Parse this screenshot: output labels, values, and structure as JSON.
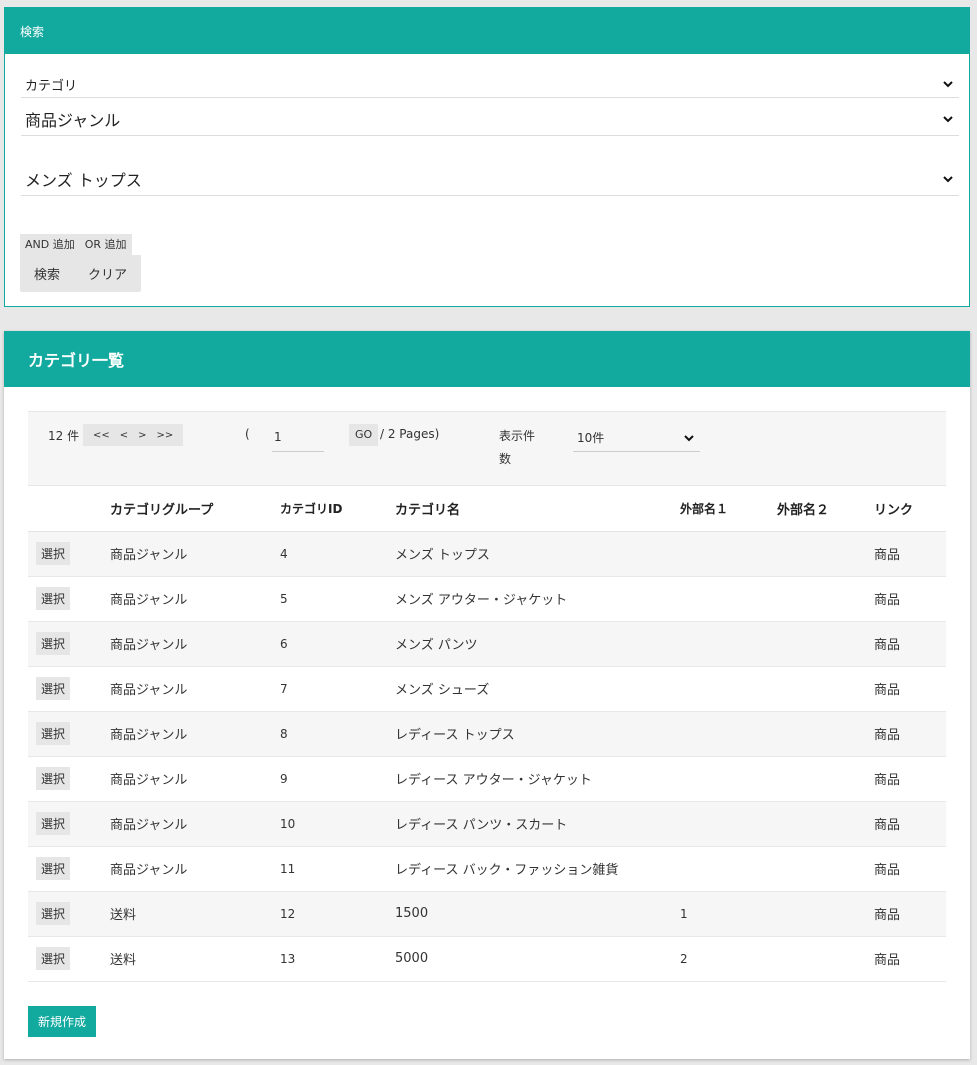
{
  "search": {
    "title": "検索",
    "category_label": "カテゴリ",
    "genre_select": "商品ジャンル",
    "category_select": "メンズ トップス",
    "and_add": "AND 追加",
    "or_add": "OR 追加",
    "search_button": "検索",
    "clear_button": "クリア"
  },
  "list": {
    "title": "カテゴリ一覧",
    "pager": {
      "count": "12 件",
      "first": "<<",
      "prev": "<",
      "next": ">",
      "last": ">>",
      "open_paren": "(",
      "page": "1",
      "go": "GO",
      "pages": "/ 2 Pages)",
      "display_label": "表示件数",
      "display_value": "10件"
    },
    "columns": [
      "",
      "カテゴリグループ",
      "カテゴリID",
      "カテゴリ名",
      "外部名１",
      "外部名２",
      "リンク"
    ],
    "rows": [
      {
        "select": "選択",
        "group": "商品ジャンル",
        "id": "4",
        "name": "メンズ トップス",
        "ext1": "",
        "ext2": "",
        "link": "商品"
      },
      {
        "select": "選択",
        "group": "商品ジャンル",
        "id": "5",
        "name": "メンズ アウター・ジャケット",
        "ext1": "",
        "ext2": "",
        "link": "商品"
      },
      {
        "select": "選択",
        "group": "商品ジャンル",
        "id": "6",
        "name": "メンズ パンツ",
        "ext1": "",
        "ext2": "",
        "link": "商品"
      },
      {
        "select": "選択",
        "group": "商品ジャンル",
        "id": "7",
        "name": "メンズ シューズ",
        "ext1": "",
        "ext2": "",
        "link": "商品"
      },
      {
        "select": "選択",
        "group": "商品ジャンル",
        "id": "8",
        "name": "レディース トップス",
        "ext1": "",
        "ext2": "",
        "link": "商品"
      },
      {
        "select": "選択",
        "group": "商品ジャンル",
        "id": "9",
        "name": "レディース アウター・ジャケット",
        "ext1": "",
        "ext2": "",
        "link": "商品"
      },
      {
        "select": "選択",
        "group": "商品ジャンル",
        "id": "10",
        "name": "レディース パンツ・スカート",
        "ext1": "",
        "ext2": "",
        "link": "商品"
      },
      {
        "select": "選択",
        "group": "商品ジャンル",
        "id": "11",
        "name": "レディース バック・ファッション雑貨",
        "ext1": "",
        "ext2": "",
        "link": "商品"
      },
      {
        "select": "選択",
        "group": "送料",
        "id": "12",
        "name": "1500",
        "ext1": "1",
        "ext2": "",
        "link": "商品"
      },
      {
        "select": "選択",
        "group": "送料",
        "id": "13",
        "name": "5000",
        "ext1": "2",
        "ext2": "",
        "link": "商品"
      }
    ],
    "new_button": "新規作成"
  },
  "colors": {
    "accent": "#12a99f",
    "background": "#e8e8e8"
  }
}
